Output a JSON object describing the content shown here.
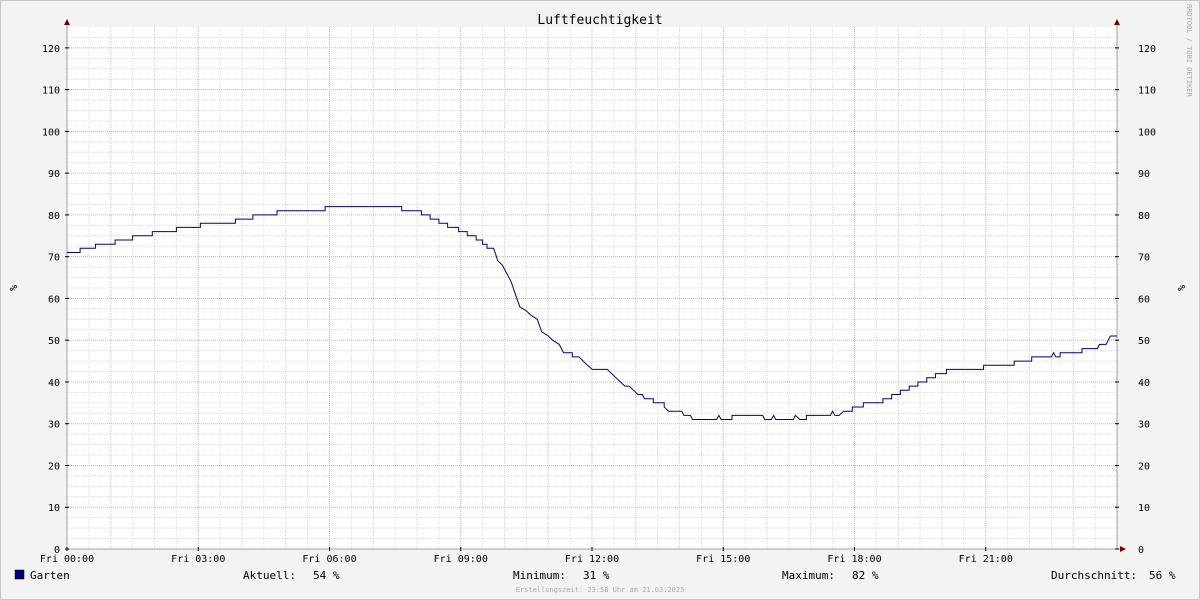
{
  "chart_data": {
    "type": "line",
    "title": "Luftfeuchtigkeit",
    "ylabel": "%",
    "ylim": [
      0,
      125
    ],
    "yticks": [
      0,
      10,
      20,
      30,
      40,
      50,
      60,
      70,
      80,
      90,
      100,
      110,
      120
    ],
    "xlim": [
      0,
      24
    ],
    "xticks": [
      {
        "x": 0,
        "label": "Fri 00:00"
      },
      {
        "x": 3,
        "label": "Fri 03:00"
      },
      {
        "x": 6,
        "label": "Fri 06:00"
      },
      {
        "x": 9,
        "label": "Fri 09:00"
      },
      {
        "x": 12,
        "label": "Fri 12:00"
      },
      {
        "x": 15,
        "label": "Fri 15:00"
      },
      {
        "x": 18,
        "label": "Fri 18:00"
      },
      {
        "x": 21,
        "label": "Fri 21:00"
      }
    ],
    "grid": true,
    "series": [
      {
        "name": "Garten",
        "color": "#000080",
        "points": [
          [
            0.0,
            71
          ],
          [
            0.3,
            71
          ],
          [
            0.3,
            72
          ],
          [
            0.65,
            72
          ],
          [
            0.65,
            73
          ],
          [
            1.1,
            73
          ],
          [
            1.1,
            74
          ],
          [
            1.5,
            74
          ],
          [
            1.5,
            75
          ],
          [
            1.95,
            75
          ],
          [
            1.95,
            76
          ],
          [
            2.5,
            76
          ],
          [
            2.5,
            77
          ],
          [
            3.05,
            77
          ],
          [
            3.05,
            78
          ],
          [
            3.85,
            78
          ],
          [
            3.85,
            79
          ],
          [
            4.25,
            79
          ],
          [
            4.25,
            80
          ],
          [
            4.8,
            80
          ],
          [
            4.8,
            81
          ],
          [
            5.9,
            81
          ],
          [
            5.9,
            82
          ],
          [
            7.65,
            82
          ],
          [
            7.65,
            81
          ],
          [
            8.1,
            81
          ],
          [
            8.1,
            80
          ],
          [
            8.3,
            80
          ],
          [
            8.3,
            79
          ],
          [
            8.5,
            79
          ],
          [
            8.5,
            78
          ],
          [
            8.7,
            78
          ],
          [
            8.7,
            77
          ],
          [
            8.95,
            77
          ],
          [
            8.95,
            76
          ],
          [
            9.15,
            76
          ],
          [
            9.15,
            75
          ],
          [
            9.35,
            75
          ],
          [
            9.35,
            74
          ],
          [
            9.5,
            74
          ],
          [
            9.5,
            73
          ],
          [
            9.6,
            73
          ],
          [
            9.6,
            72
          ],
          [
            9.75,
            72
          ],
          [
            9.85,
            69
          ],
          [
            9.95,
            68
          ],
          [
            10.05,
            66
          ],
          [
            10.15,
            64
          ],
          [
            10.25,
            61
          ],
          [
            10.35,
            58
          ],
          [
            10.5,
            57
          ],
          [
            10.6,
            56
          ],
          [
            10.75,
            55
          ],
          [
            10.85,
            52
          ],
          [
            11.0,
            51
          ],
          [
            11.1,
            50
          ],
          [
            11.25,
            49
          ],
          [
            11.35,
            47
          ],
          [
            11.55,
            47
          ],
          [
            11.55,
            46
          ],
          [
            11.7,
            46
          ],
          [
            11.8,
            45
          ],
          [
            11.9,
            44
          ],
          [
            12.0,
            43
          ],
          [
            12.15,
            43
          ],
          [
            12.35,
            43
          ],
          [
            12.45,
            42
          ],
          [
            12.55,
            41
          ],
          [
            12.65,
            40
          ],
          [
            12.75,
            39
          ],
          [
            12.85,
            39
          ],
          [
            12.95,
            38
          ],
          [
            13.05,
            37
          ],
          [
            13.15,
            37
          ],
          [
            13.2,
            36
          ],
          [
            13.4,
            36
          ],
          [
            13.4,
            35
          ],
          [
            13.65,
            35
          ],
          [
            13.65,
            34
          ],
          [
            13.75,
            33
          ],
          [
            14.05,
            33
          ],
          [
            14.1,
            32
          ],
          [
            14.25,
            32
          ],
          [
            14.3,
            31
          ],
          [
            14.85,
            31
          ],
          [
            14.9,
            32
          ],
          [
            14.95,
            31
          ],
          [
            15.2,
            31
          ],
          [
            15.2,
            32
          ],
          [
            15.9,
            32
          ],
          [
            15.95,
            31
          ],
          [
            16.1,
            31
          ],
          [
            16.15,
            32
          ],
          [
            16.2,
            31
          ],
          [
            16.6,
            31
          ],
          [
            16.65,
            32
          ],
          [
            16.75,
            31
          ],
          [
            16.9,
            31
          ],
          [
            16.9,
            32
          ],
          [
            17.45,
            32
          ],
          [
            17.5,
            33
          ],
          [
            17.55,
            32
          ],
          [
            17.65,
            32
          ],
          [
            17.75,
            33
          ],
          [
            17.95,
            33
          ],
          [
            17.95,
            34
          ],
          [
            18.2,
            34
          ],
          [
            18.2,
            35
          ],
          [
            18.65,
            35
          ],
          [
            18.65,
            36
          ],
          [
            18.85,
            36
          ],
          [
            18.85,
            37
          ],
          [
            19.05,
            37
          ],
          [
            19.05,
            38
          ],
          [
            19.25,
            38
          ],
          [
            19.25,
            39
          ],
          [
            19.45,
            39
          ],
          [
            19.45,
            40
          ],
          [
            19.65,
            40
          ],
          [
            19.65,
            41
          ],
          [
            19.85,
            41
          ],
          [
            19.85,
            42
          ],
          [
            20.1,
            42
          ],
          [
            20.1,
            43
          ],
          [
            20.95,
            43
          ],
          [
            20.95,
            44
          ],
          [
            21.65,
            44
          ],
          [
            21.65,
            45
          ],
          [
            22.05,
            45
          ],
          [
            22.05,
            46
          ],
          [
            22.5,
            46
          ],
          [
            22.55,
            47
          ],
          [
            22.6,
            46
          ],
          [
            22.7,
            46
          ],
          [
            22.7,
            47
          ],
          [
            23.2,
            47
          ],
          [
            23.2,
            48
          ],
          [
            23.55,
            48
          ],
          [
            23.6,
            49
          ],
          [
            23.75,
            49
          ],
          [
            23.8,
            50
          ],
          [
            23.85,
            51
          ],
          [
            24.0,
            51
          ]
        ]
      }
    ],
    "legend": {
      "name": "Garten",
      "current_label": "Aktuell:",
      "current_value": "54 %",
      "min_label": "Minimum:",
      "min_value": "31 %",
      "max_label": "Maximum:",
      "max_value": "82 %",
      "avg_label": "Durchschnitt:",
      "avg_value": "56 %"
    },
    "footer": "Erstellungszeit: 23:58 Uhr am 21.03.2025",
    "watermark": "RRDTOOL / TOBI OETIKER"
  }
}
